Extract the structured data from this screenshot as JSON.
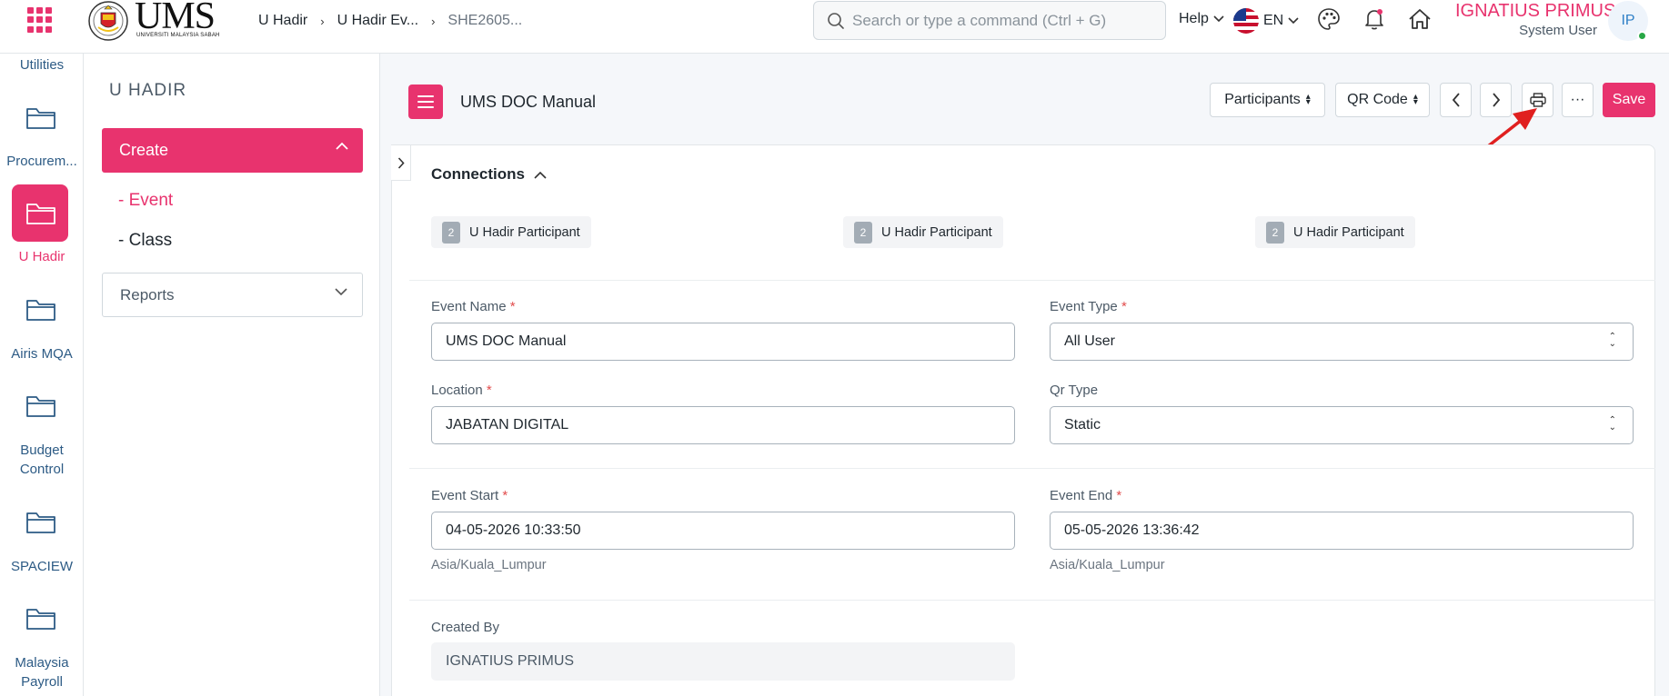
{
  "topbar": {
    "logo_text": "UMS",
    "logo_subtext": "UNIVERSITI MALAYSIA SABAH",
    "breadcrumbs": [
      "U Hadir",
      "U Hadir Ev...",
      "SHE2605..."
    ],
    "search_placeholder": "Search or type a command (Ctrl + G)",
    "help_label": "Help",
    "language": "EN",
    "user_name": "IGNATIUS PRIMUS",
    "user_role": "System User",
    "avatar_initials": "IP"
  },
  "rail": {
    "items": [
      "Utilities",
      "Procurem...",
      "U Hadir",
      "Airis MQA",
      "Budget Control",
      "SPACIEW",
      "Malaysia Payroll"
    ],
    "active": "U Hadir"
  },
  "sidebar": {
    "title": "U HADIR",
    "create_label": "Create",
    "links": [
      "- Event",
      "- Class"
    ],
    "reports_label": "Reports"
  },
  "toolbar": {
    "doc_title": "UMS DOC Manual",
    "participants_label": "Participants",
    "qrcode_label": "QR Code",
    "more_label": "···",
    "save_label": "Save"
  },
  "connections": {
    "title": "Connections",
    "items": [
      {
        "count": "2",
        "label": "U Hadir Participant"
      },
      {
        "count": "2",
        "label": "U Hadir Participant"
      },
      {
        "count": "2",
        "label": "U Hadir Participant"
      }
    ]
  },
  "form": {
    "event_name_label": "Event Name",
    "event_name_value": "UMS DOC Manual",
    "event_type_label": "Event Type",
    "event_type_value": "All User",
    "location_label": "Location",
    "location_value": "JABATAN DIGITAL",
    "qr_type_label": "Qr Type",
    "qr_type_value": "Static",
    "event_start_label": "Event Start",
    "event_start_value": "04-05-2026 10:33:50",
    "event_start_tz": "Asia/Kuala_Lumpur",
    "event_end_label": "Event End",
    "event_end_value": "05-05-2026 13:36:42",
    "event_end_tz": "Asia/Kuala_Lumpur",
    "created_by_label": "Created By",
    "created_by_value": "IGNATIUS PRIMUS",
    "required_mark": "*"
  },
  "colors": {
    "accent": "#e8336e",
    "annotation_arrow": "#e02020"
  }
}
